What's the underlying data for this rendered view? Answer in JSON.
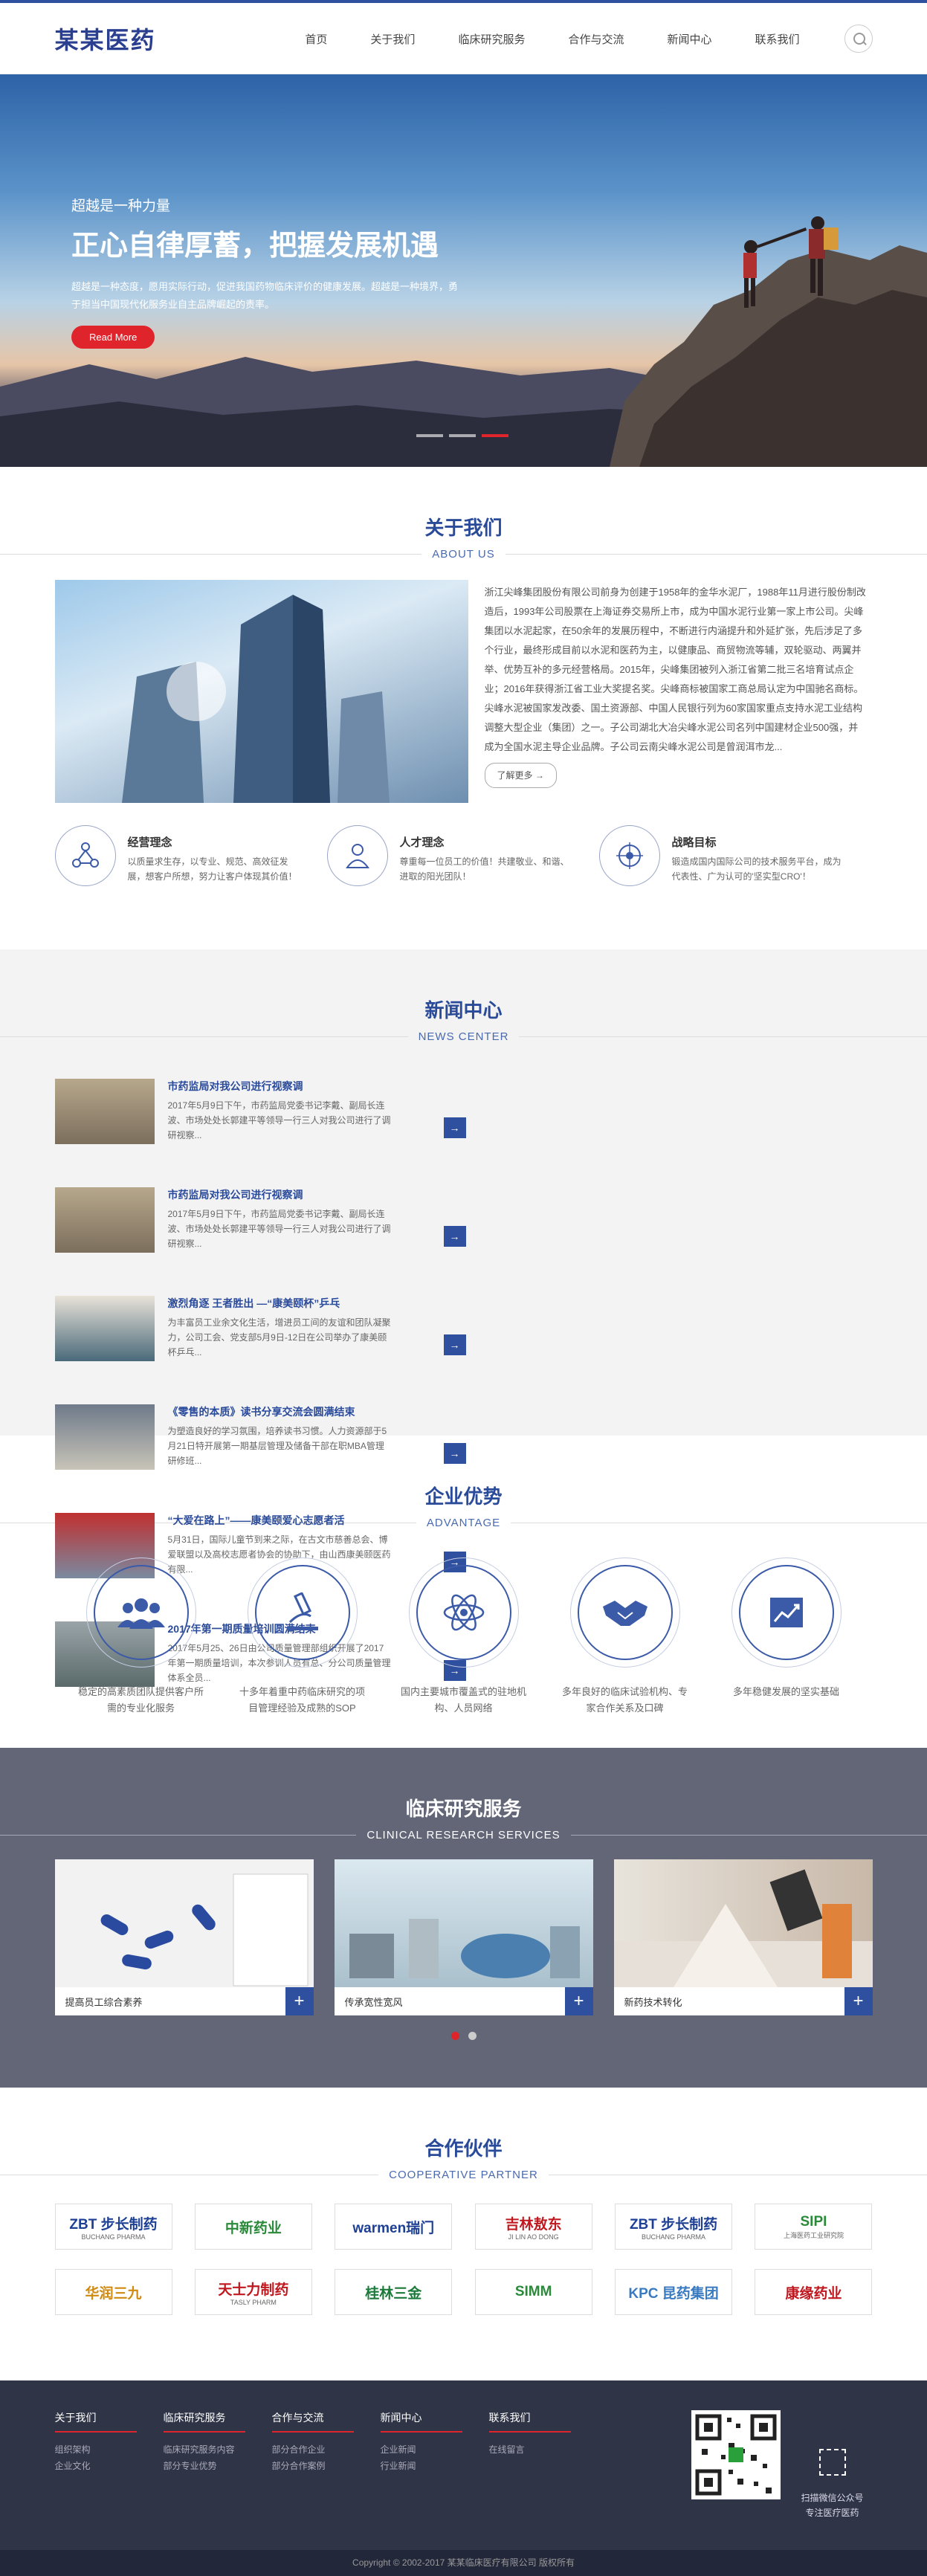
{
  "header": {
    "logo": "某某医药",
    "nav": [
      "首页",
      "关于我们",
      "临床研究服务",
      "合作与交流",
      "新闻中心",
      "联系我们"
    ]
  },
  "banner": {
    "sub": "超越是一种力量",
    "title": "正心自律厚蓄，把握发展机遇",
    "desc": "超越是一种态度，愿用实际行动，促进我国药物临床评价的健康发展。超越是一种境界，勇于担当中国现代化服务业自主品牌崛起的责率。",
    "button": "Read More"
  },
  "about": {
    "title": "关于我们",
    "en": "ABOUT US",
    "text": "浙江尖峰集团股份有限公司前身为创建于1958年的金华水泥厂，1988年11月进行股份制改造后，1993年公司股票在上海证券交易所上市，成为中国水泥行业第一家上市公司。尖峰集团以水泥起家，在50余年的发展历程中，不断进行内涵提升和外延扩张，先后涉足了多个行业，最终形成目前以水泥和医药为主，以健康品、商贸物流等辅，双轮驱动、两翼并举、优势互补的多元经营格局。2015年，尖峰集团被列入浙江省第二批三名培育试点企业；2016年获得浙江省工业大奖提名奖。尖峰商标被国家工商总局认定为中国驰名商标。尖峰水泥被国家发改委、国土资源部、中国人民银行列为60家国家重点支持水泥工业结构调整大型企业（集团）之一。子公司湖北大冶尖峰水泥公司名列中国建材企业500强，并成为全国水泥主导企业品牌。子公司云南尖峰水泥公司是曾润洱市龙...",
    "more": "了解更多 →",
    "ideas": [
      {
        "title": "经营理念",
        "desc": "以质量求生存，以专业、规范、高效征发展，想客户所想，努力让客户体现其价值！"
      },
      {
        "title": "人才理念",
        "desc": "尊重每一位员工的价值！共建敬业、和谐、进取的阳光团队！"
      },
      {
        "title": "战略目标",
        "desc": "锻造成国内国际公司的技术服务平台，成为代表性、广为认可的'坚实型CRO'！"
      }
    ]
  },
  "news": {
    "title": "新闻中心",
    "en": "NEWS CENTER",
    "items": [
      {
        "title": "市药监局对我公司进行视察调",
        "desc": "2017年5月9日下午，市药监局党委书记李戴、副局长连波、市场处处长郭建平等领导一行三人对我公司进行了调研视察..."
      },
      {
        "title": "市药监局对我公司进行视察调",
        "desc": "2017年5月9日下午，市药监局党委书记李戴、副局长连波、市场处处长郭建平等领导一行三人对我公司进行了调研视察..."
      },
      {
        "title": "激烈角逐 王者胜出 —“康美颐杯”乒乓",
        "desc": "为丰富员工业余文化生活，增进员工间的友谊和团队凝聚力，公司工会、党支部5月9日-12日在公司举办了康美颐杯乒乓..."
      },
      {
        "title": "《零售的本质》读书分享交流会圆满结束",
        "desc": "为塑造良好的学习氛围，培养读书习惯。人力资源部于5月21日特开展第一期基层管理及储备干部在职MBA管理研修班..."
      },
      {
        "title": "“大爱在路上”——康美颐爱心志愿者活",
        "desc": "5月31日，国际儿童节到来之际，在古文市慈善总会、博爱联盟以及高校志愿者协会的协助下，由山西康美颐医药有限..."
      },
      {
        "title": "2017年第一期质量培训圆满结束",
        "desc": "2017年5月25、26日由公司质量管理部组织开展了2017年第一期质量培训，本次参训人员有总、分公司质量管理体系全员..."
      }
    ]
  },
  "adv": {
    "title": "企业优势",
    "en": "ADVANTAGE",
    "items": [
      "稳定的高素质团队提供客户所需的专业化服务",
      "十多年着重中药临床研究的项目管理经验及成熟的SOP",
      "国内主要城市覆盖式的驻地机构、人员网络",
      "多年良好的临床试验机构、专家合作关系及口碑",
      "多年稳健发展的坚实基础"
    ]
  },
  "clinical": {
    "title": "临床研究服务",
    "en": "CLINICAL RESEARCH SERVICES",
    "items": [
      "提高员工综合素养",
      "传承宽性宽风",
      "新药技术转化"
    ]
  },
  "partners": {
    "title": "合作伙伴",
    "en": "COOPERATIVE PARTNER",
    "logos": [
      {
        "name": "ZBT 步长制药",
        "sub": "BUCHANG PHARMA",
        "color": "#1d3f94"
      },
      {
        "name": "中新药业",
        "sub": "",
        "color": "#2a8a3a"
      },
      {
        "name": "warmen瑞门",
        "sub": "",
        "color": "#1d3f94"
      },
      {
        "name": "吉林敖东",
        "sub": "JI LIN AO DONG",
        "color": "#c0181f"
      },
      {
        "name": "ZBT 步长制药",
        "sub": "BUCHANG PHARMA",
        "color": "#1d3f94"
      },
      {
        "name": "SIPI",
        "sub": "上海医药工业研究院",
        "color": "#2a8a3a"
      },
      {
        "name": "华润三九",
        "sub": "",
        "color": "#d08a10"
      },
      {
        "name": "天士力制药",
        "sub": "TASLY PHARM",
        "color": "#c0181f"
      },
      {
        "name": "桂林三金",
        "sub": "",
        "color": "#1b7a3a"
      },
      {
        "name": "SIMM",
        "sub": "",
        "color": "#2a8a3a"
      },
      {
        "name": "KPC 昆药集团",
        "sub": "",
        "color": "#3a7ac0"
      },
      {
        "name": "康缘药业",
        "sub": "",
        "color": "#c0181f"
      }
    ]
  },
  "footer": {
    "cols": [
      {
        "title": "关于我们",
        "links": [
          "组织架构",
          "企业文化"
        ]
      },
      {
        "title": "临床研究服务",
        "links": [
          "临床研究服务内容",
          "部分专业优势"
        ]
      },
      {
        "title": "合作与交流",
        "links": [
          "部分合作企业",
          "部分合作案例"
        ]
      },
      {
        "title": "新闻中心",
        "links": [
          "企业新闻",
          "行业新闻"
        ]
      },
      {
        "title": "联系我们",
        "links": [
          "在线留言"
        ]
      }
    ],
    "qr_text1": "扫描微信公众号",
    "qr_text2": "专注医疗医药",
    "copyright": "Copyright © 2002-2017 某某临床医疗有限公司 版权所有"
  }
}
